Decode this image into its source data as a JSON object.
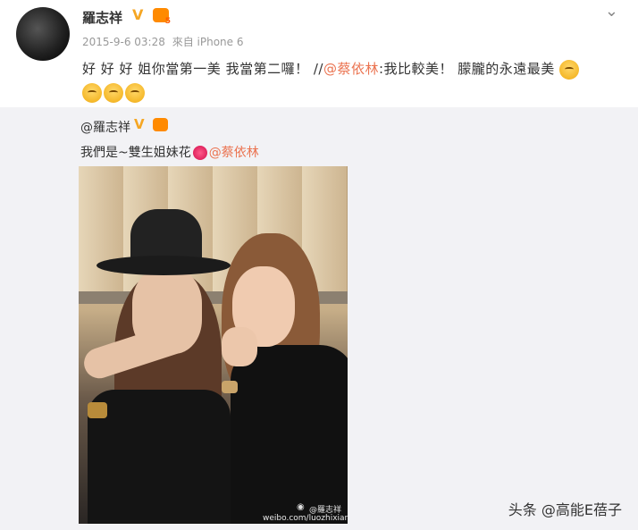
{
  "post": {
    "username": "羅志祥",
    "verified_badge": "V",
    "member_icon": "weibo-member-icon",
    "timestamp": "2015-9-6 03:28",
    "source": "來自 iPhone 6",
    "menu_icon": "chevron-down-icon",
    "text": {
      "part1": "好 好 好 姐你當第一美 我當第二囉！ //",
      "mention": "@蔡依林",
      "part2": ":我比較美！  朦朧的永遠最美"
    },
    "emojis": [
      "shush-face-emoji",
      "shy-face-emoji",
      "shy-face-emoji",
      "shy-face-emoji"
    ]
  },
  "repost": {
    "author": "@羅志祥",
    "verified_badge": "V",
    "text_prefix": "我們是~雙生姐妹花",
    "flower_icon": "flower-icon",
    "mention": "@蔡依林",
    "photo": {
      "description_icon": "photo",
      "watermark_handle": "@羅志祥",
      "watermark_url": "weibo.com/luozhixiang"
    }
  },
  "footer": {
    "watermark": "头条 @高能E蓓子"
  },
  "colors": {
    "accent": "#eb7350",
    "badge": "#f5a623",
    "repost_bg": "#f2f2f5"
  }
}
